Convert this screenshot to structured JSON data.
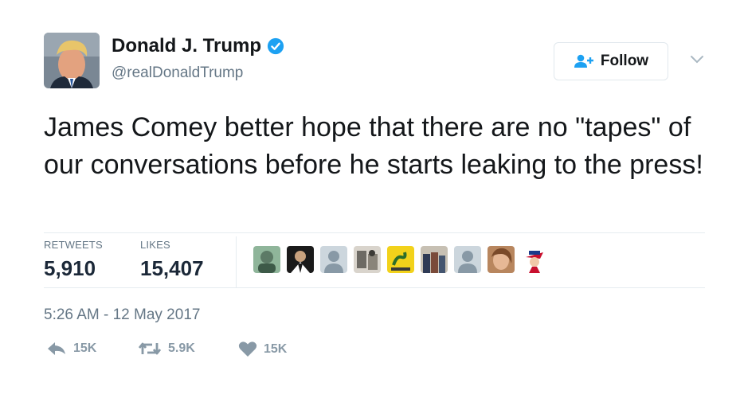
{
  "author": {
    "name": "Donald J. Trump",
    "handle": "@realDonaldTrump",
    "verified_icon": "verified-badge-icon",
    "avatar_icon": "profile-photo"
  },
  "follow": {
    "label": "Follow",
    "icon": "add-user-icon"
  },
  "menu": {
    "icon": "chevron-down-icon"
  },
  "tweet": {
    "text": "James Comey better hope that there are no \"tapes\" of our conversations before he starts leaking to the press!"
  },
  "stats": {
    "retweets_label": "RETWEETS",
    "retweets_value": "5,910",
    "likes_label": "LIKES",
    "likes_value": "15,407"
  },
  "liker_avatars": [
    "liker-avatar-1",
    "liker-avatar-2",
    "liker-avatar-3",
    "liker-avatar-4",
    "liker-avatar-5",
    "liker-avatar-6",
    "liker-avatar-7",
    "liker-avatar-8",
    "liker-avatar-9"
  ],
  "timestamp": "5:26 AM - 12 May 2017",
  "actions": {
    "reply": {
      "icon": "reply-icon",
      "count": "15K"
    },
    "retweet": {
      "icon": "retweet-icon",
      "count": "5.9K"
    },
    "like": {
      "icon": "heart-icon",
      "count": "15K"
    }
  },
  "colors": {
    "text": "#14171a",
    "secondary": "#657786",
    "accent": "#1da1f2",
    "action_gray": "#8899a6",
    "divider": "#e6ecf0"
  }
}
